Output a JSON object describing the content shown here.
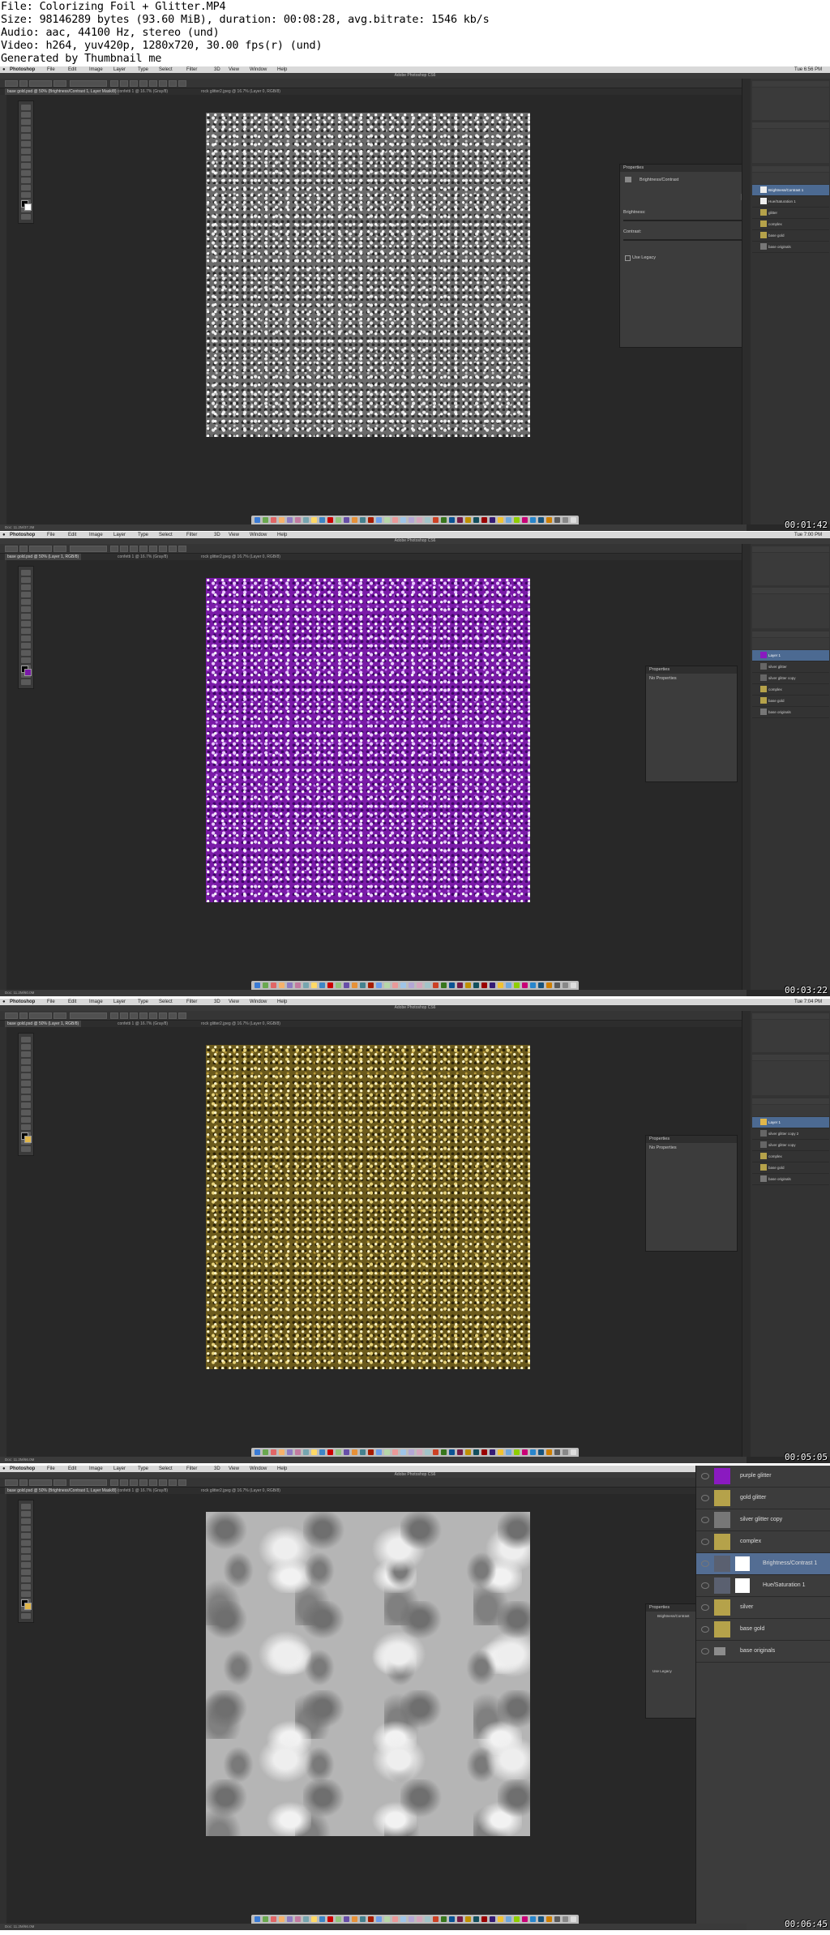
{
  "header": {
    "file": "File: Colorizing Foil + Glitter.MP4",
    "size": "Size: 98146289 bytes (93.60 MiB), duration: 00:08:28, avg.bitrate: 1546 kb/s",
    "audio": "Audio: aac, 44100 Hz, stereo (und)",
    "video": "Video: h264, yuv420p, 1280x720, 30.00 fps(r) (und)",
    "generator": "Generated by Thumbnail me"
  },
  "app": {
    "name": "Photoshop",
    "title": "Adobe Photoshop CS6",
    "menus": [
      "File",
      "Edit",
      "Image",
      "Layer",
      "Type",
      "Select",
      "Filter",
      "3D",
      "View",
      "Window",
      "Help"
    ]
  },
  "frames": [
    {
      "timestamp": "00:01:42",
      "clock": "Tue 6:56 PM",
      "active_tab": "base gold.psd @ 50% (Brightness/Contrast 1, Layer Mask/8)",
      "tabs": [
        "confetti 1 @ 16.7% (Gray/8)",
        "rock glitter2.jpeg @ 16.7% (Layer 0, RGB/8)"
      ],
      "texture": "silver",
      "properties": {
        "title": "Properties",
        "adjustment": "Brightness/Contrast",
        "auto": "Auto",
        "brightness_label": "Brightness:",
        "brightness_value": "23",
        "contrast_label": "Contrast:",
        "contrast_value": "39",
        "legacy": "Use Legacy"
      },
      "layers": [
        "Brightness/Contrast 1",
        "Hue/Saturation 1",
        "glitter",
        "complex",
        "base gold",
        "base originals"
      ],
      "status": "Doc: 11.2M/37.3M"
    },
    {
      "timestamp": "00:03:22",
      "clock": "Tue 7:00 PM",
      "active_tab": "base gold.psd @ 50% (Layer 1, RGB/8)",
      "tabs": [
        "confetti 1 @ 16.7% (Gray/8)",
        "rock glitter2.jpeg @ 16.7% (Layer 0, RGB/8)"
      ],
      "texture": "purple",
      "properties": {
        "title": "Properties",
        "empty": "No Properties"
      },
      "layers": [
        "Layer 1",
        "silver glitter",
        "silver glitter copy",
        "complex",
        "base gold",
        "base originals"
      ],
      "status": "Doc: 11.2M/60.0M"
    },
    {
      "timestamp": "00:05:05",
      "clock": "Tue 7:04 PM",
      "active_tab": "base gold.psd @ 50% (Layer 1, RGB/8)",
      "tabs": [
        "confetti 1 @ 16.7% (Gray/8)",
        "rock glitter2.jpeg @ 16.7% (Layer 0, RGB/8)"
      ],
      "texture": "gold",
      "properties": {
        "title": "Properties",
        "empty": "No Properties"
      },
      "layers": [
        "Layer 1",
        "silver glitter copy 2",
        "silver glitter copy",
        "complex",
        "base gold",
        "base originals"
      ],
      "status": "Doc: 11.2M/66.0M"
    },
    {
      "timestamp": "00:06:45",
      "clock": "Tue 7:05 PM",
      "active_tab": "base gold.psd @ 50% (Brightness/Contrast 1, Layer Mask/8)",
      "tabs": [
        "confetti 1 @ 16.7% (Gray/8)",
        "rock glitter2.jpeg @ 16.7% (Layer 0, RGB/8)"
      ],
      "texture": "foil",
      "properties": {
        "title": "Properties",
        "adjustment": "Brightness/Contrast",
        "legacy": "Use Legacy"
      },
      "zoomed_layers": [
        "purple glitter",
        "gold glitter",
        "silver glitter copy",
        "complex",
        "Brightness/Contrast 1",
        "Hue/Saturation 1",
        "silver",
        "base gold",
        "base originals"
      ],
      "status": "Doc: 11.2M/66.0M"
    }
  ],
  "colors": {
    "silver_base": "#6a6a6a",
    "purple_base": "#7a1aa8",
    "gold_base": "#6b5a1c",
    "selection_blue": "#4c6a92"
  }
}
